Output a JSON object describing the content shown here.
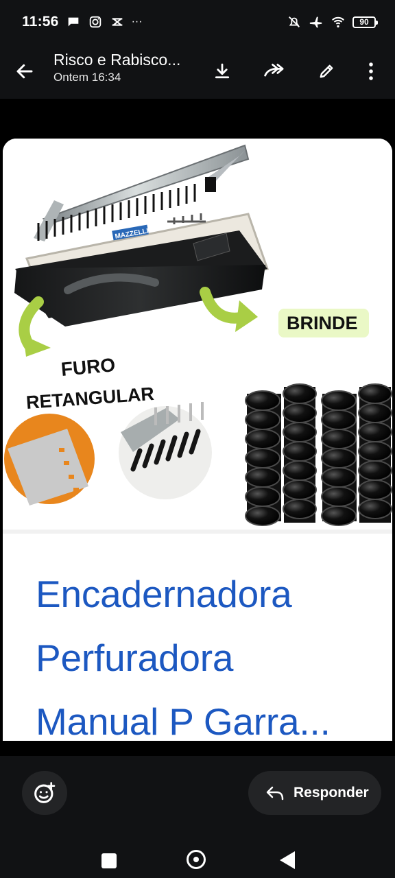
{
  "status_bar": {
    "time": "11:56",
    "battery": "90",
    "more": "···"
  },
  "header": {
    "title": "Risco e Rabisco...",
    "subtitle": "Ontem 16:34"
  },
  "image_text": {
    "brand": "MAZZELLI",
    "brinde": "BRINDE",
    "furo_line_1": "FURO",
    "furo_line_2": "RETANGULAR"
  },
  "product": {
    "title_lines": [
      "Encadernadora",
      "Perfuradora",
      "Manual P Garra..."
    ]
  },
  "actions": {
    "reply_label": "Responder"
  },
  "colors": {
    "link_blue": "#1c58c1",
    "green_arrow": "#a9ce45",
    "orange": "#e8861d",
    "dark_panel": "#111214"
  },
  "icons": {
    "back": "back-arrow-icon",
    "download": "download-icon",
    "forward": "forward-icon",
    "edit": "pencil-icon",
    "more": "more-vert-icon",
    "emoji": "emoji-add-icon",
    "reply": "reply-icon"
  }
}
